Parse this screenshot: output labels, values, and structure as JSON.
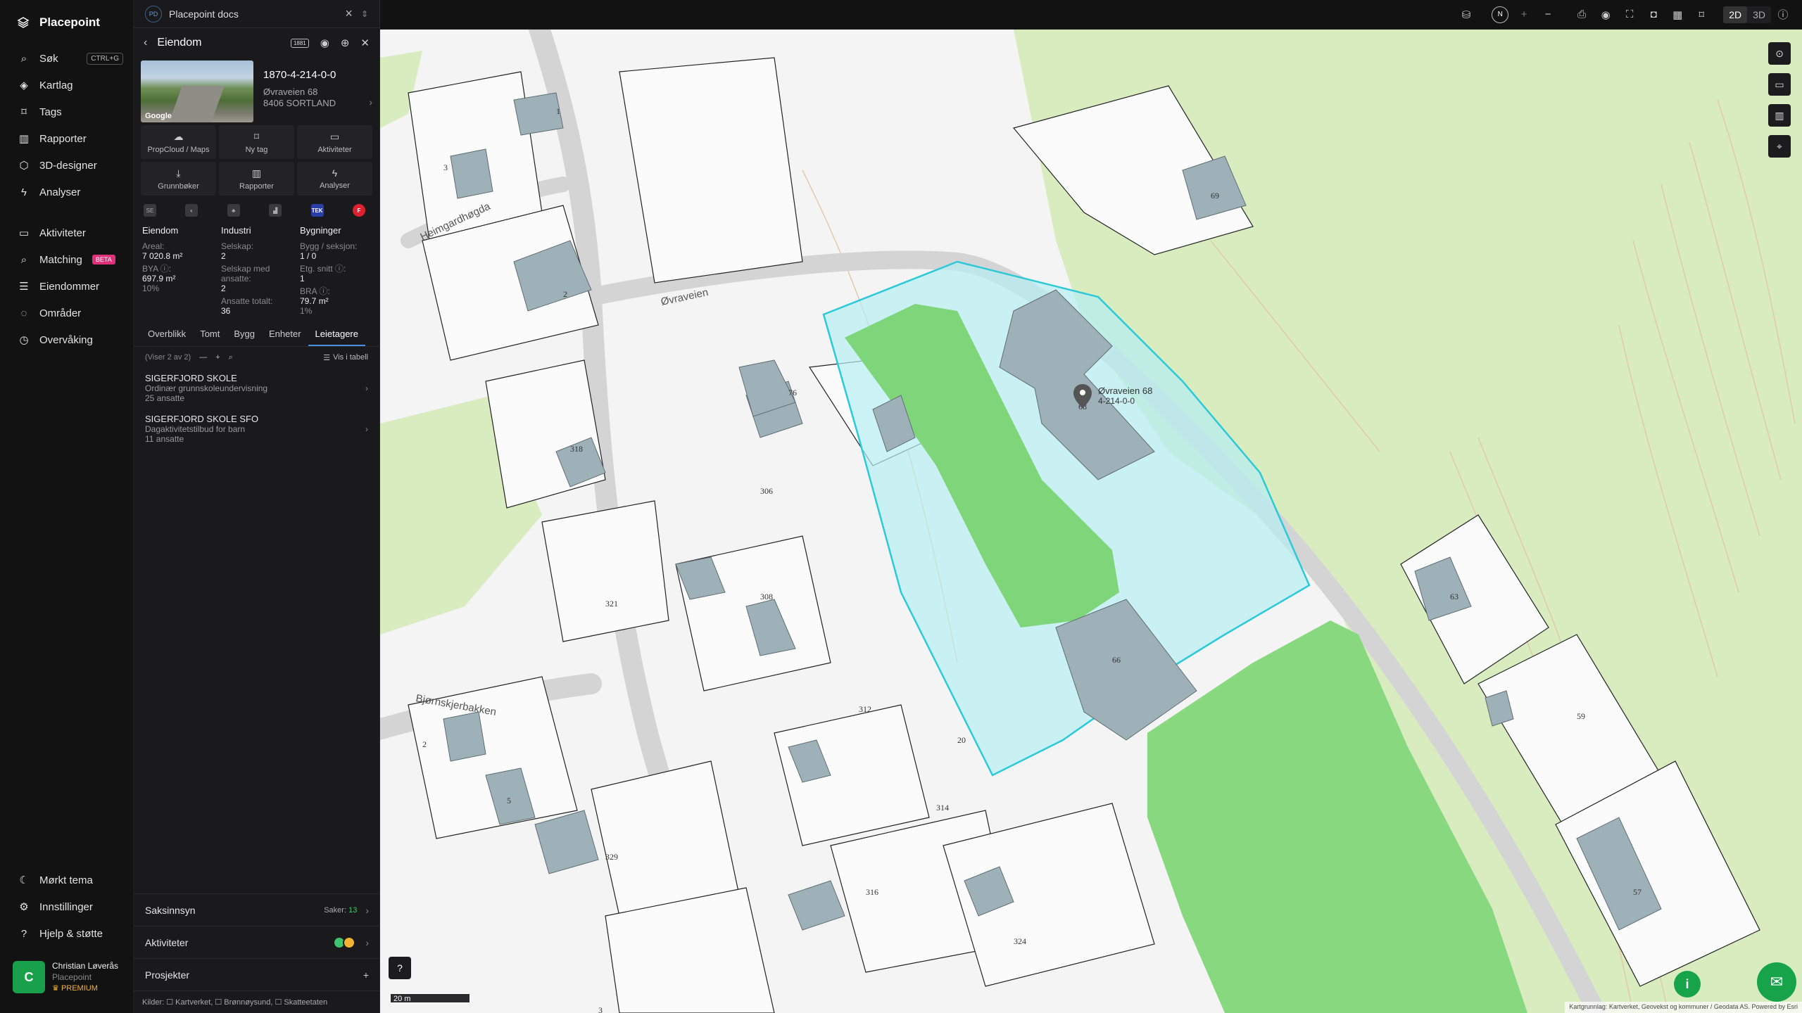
{
  "nav": {
    "brand": "Placepoint",
    "items": [
      {
        "label": "Søk",
        "kbd": "CTRL+G",
        "icon": "search-icon"
      },
      {
        "label": "Kartlag",
        "icon": "layers-icon"
      },
      {
        "label": "Tags",
        "icon": "bookmark-icon"
      },
      {
        "label": "Rapporter",
        "icon": "chart-icon"
      },
      {
        "label": "3D-designer",
        "icon": "cube-icon"
      },
      {
        "label": "Analyser",
        "icon": "bolt-icon"
      }
    ],
    "items2": [
      {
        "label": "Aktiviteter",
        "icon": "chat-icon"
      },
      {
        "label": "Matching",
        "badge": "BETA",
        "icon": "match-icon"
      },
      {
        "label": "Eiendommer",
        "icon": "list-icon"
      },
      {
        "label": "Områder",
        "icon": "area-icon"
      },
      {
        "label": "Overvåking",
        "icon": "clock-icon"
      }
    ],
    "bottom": [
      {
        "label": "Mørkt tema",
        "icon": "moon-icon"
      },
      {
        "label": "Innstillinger",
        "icon": "gear-icon"
      },
      {
        "label": "Hjelp & støtte",
        "icon": "help-icon"
      }
    ],
    "user": {
      "initial": "C",
      "name": "Christian Løverås",
      "org": "Placepoint",
      "plan": "PREMIUM"
    }
  },
  "panel": {
    "doc_logo": "PD",
    "doc_title": "Placepoint docs",
    "header": "Eiendom",
    "header_badge": "1881",
    "property": {
      "id": "1870-4-214-0-0",
      "street": "Øvraveien 68",
      "city": "8406 SORTLAND",
      "photo_credit": "Google"
    },
    "actions": [
      {
        "label": "PropCloud / Maps",
        "icon": "cloud-icon",
        "glyph": "☁"
      },
      {
        "label": "Ny tag",
        "icon": "bookmark-icon",
        "glyph": "⌑"
      },
      {
        "label": "Aktiviteter",
        "icon": "chat-icon",
        "glyph": "▭"
      },
      {
        "label": "Grunnbøker",
        "icon": "download-icon",
        "glyph": "⤓"
      },
      {
        "label": "Rapporter",
        "icon": "chart-icon",
        "glyph": "▥"
      },
      {
        "label": "Analyser",
        "icon": "bolt-icon",
        "glyph": "ϟ"
      }
    ],
    "source_tek": "TEK",
    "source_f": "F",
    "stats": {
      "eiendom": {
        "title": "Eiendom",
        "areal_label": "Areal:",
        "areal": "7 020.8 m²",
        "bya_label": "BYA ⓘ:",
        "bya": "697.9 m²",
        "bya_pct": "10%"
      },
      "industri": {
        "title": "Industri",
        "selskap_label": "Selskap:",
        "selskap": "2",
        "ansatte_label": "Selskap med ansatte:",
        "ansatte": "2",
        "totalt_label": "Ansatte totalt:",
        "totalt": "36"
      },
      "bygninger": {
        "title": "Bygninger",
        "bygg_label": "Bygg / seksjon:",
        "bygg": "1 / 0",
        "etg_label": "Etg. snitt ⓘ:",
        "etg": "1",
        "bra_label": "BRA ⓘ:",
        "bra": "79.7 m²",
        "bra_pct": "1%"
      }
    },
    "tabs": [
      "Overblikk",
      "Tomt",
      "Bygg",
      "Enheter",
      "Leietagere"
    ],
    "active_tab": "Leietagere",
    "list_count": "(Viser 2 av 2)",
    "vis_tabell": "Vis i tabell",
    "tenants": [
      {
        "name": "SIGERFJORD SKOLE",
        "desc": "Ordinær grunnskoleundervisning",
        "emp": "25 ansatte"
      },
      {
        "name": "SIGERFJORD SKOLE SFO",
        "desc": "Dagaktivitetstilbud for barn",
        "emp": "11 ansatte"
      }
    ],
    "sections": {
      "saksinnsyn": "Saksinnsyn",
      "saker_label": "Saker:",
      "saker": "13",
      "aktiviteter": "Aktiviteter",
      "prosjekter": "Prosjekter"
    },
    "kilder": "Kilder:  ☐ Kartverket,  ☐ Brønnøysund,  ☐ Skatteetaten"
  },
  "topbar": {
    "compass": "N",
    "mode_2d": "2D",
    "mode_3d": "3D"
  },
  "map": {
    "marker_label": "Øvraveien 68",
    "marker_sub": "4-214-0-0",
    "scale": "20 m",
    "attribution": "Kartgrunnlag: Kartverket, Geovekst og kommuner / Geodata AS. Powered by Esri",
    "roads": [
      "Øvraveien",
      "Heimgardhøgda",
      "Bjørnskjerbakken"
    ],
    "house_numbers": [
      "1",
      "3",
      "2",
      "69",
      "76",
      "318",
      "306",
      "308",
      "321",
      "312",
      "314",
      "316",
      "329",
      "5",
      "2",
      "66",
      "68",
      "63",
      "59",
      "57",
      "324",
      "3",
      "20"
    ],
    "colors": {
      "parcel": "#b6eef2",
      "parcel_stroke": "#2cc9d9",
      "green": "#7fd67a",
      "forest": "#d8ecc0",
      "building": "#9fb1b8"
    }
  }
}
